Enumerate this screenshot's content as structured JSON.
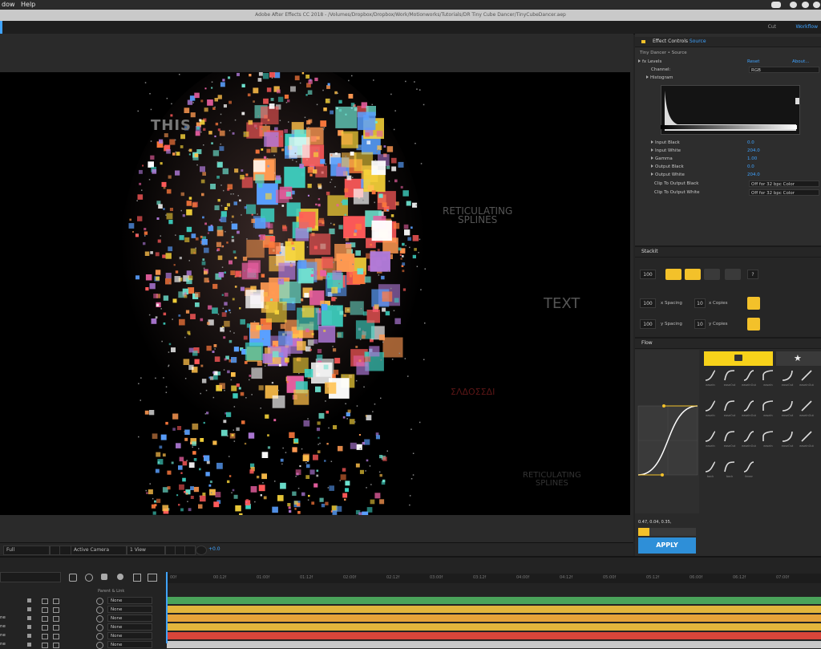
{
  "menubar": {
    "items": [
      "dow",
      "Help"
    ]
  },
  "titlebar": {
    "title": "Adobe After Effects CC 2018 - /Volumes/Dropbox/Dropbox/Work/Motionworks/Tutorials/DR Tiny Cube Dancer/TinyCubeDancer.aep"
  },
  "workspace": {
    "cut": "Cut",
    "workflow": "Workflow"
  },
  "canvas": {
    "word_this": "THIS",
    "word_reticulating": "RETICULATING",
    "word_splines": "SPLINES",
    "word_text": "TEXT",
    "word_red": "ΣΛΔΟΣΣΔΙ",
    "word_bottom1": "RETICULATING",
    "word_bottom2": "SPLINES"
  },
  "viewer_bar": {
    "resolution": "Full",
    "camera": "Active Camera",
    "views": "1 View",
    "exposure": "+0.0"
  },
  "effect_controls": {
    "tab": "Effect Controls",
    "tab_layer": "Source",
    "layer_path": "Tiny Dancer • Source",
    "effect_name": "Levels",
    "reset": "Reset",
    "about": "About...",
    "channel_label": "Channel:",
    "channel_value": "RGB",
    "histogram_label": "Histogram",
    "params": [
      {
        "label": "Input Black",
        "value": "0.0"
      },
      {
        "label": "Input White",
        "value": "204.0"
      },
      {
        "label": "Gamma",
        "value": "1.00"
      },
      {
        "label": "Output Black",
        "value": "0.0"
      },
      {
        "label": "Output White",
        "value": "204.0"
      }
    ],
    "clip_black_label": "Clip To Output Black",
    "clip_black_value": "Off for 32 bpc Color",
    "clip_white_label": "Clip To Output White",
    "clip_white_value": "Off for 32 bpc Color"
  },
  "stackit": {
    "title": "Stackit",
    "copies_value": "100",
    "x_value": "100",
    "x_label": "x Spacing",
    "x_copies_value": "10",
    "x_copies_label": "x Copies",
    "y_value": "100",
    "y_label": "y Spacing",
    "y_copies_value": "10",
    "y_copies_label": "y Copies",
    "help": "?"
  },
  "flow": {
    "title": "Flow",
    "apply_label": "APPLY",
    "bezier_readout": "0.47, 0.04, 0.35,",
    "presets": [
      "easeIn",
      "easeOut",
      "easeInOut",
      "easeIn",
      "easeOut",
      "easeInOut",
      "easeIn",
      "easeOut",
      "easeInOut",
      "easeIn",
      "easeOut",
      "easeInOut",
      "easeIn",
      "easeOut",
      "easeInOut",
      "easeIn",
      "easeOut",
      "easeInOut",
      "back",
      "back",
      "linear"
    ]
  },
  "timeline": {
    "parent_header": "Parent & Link",
    "rows": [
      {
        "name": "",
        "parent": "None"
      },
      {
        "name": "",
        "parent": "None"
      },
      {
        "name": "ne",
        "parent": "None"
      },
      {
        "name": "ne",
        "parent": "None"
      },
      {
        "name": "ne",
        "parent": "None"
      },
      {
        "name": "ne",
        "parent": "None"
      }
    ],
    "ticks": [
      "00f",
      "00:12f",
      "01:00f",
      "01:12f",
      "02:00f",
      "02:12f",
      "03:00f",
      "03:12f",
      "04:00f",
      "04:12f",
      "05:00f",
      "05:12f",
      "06:00f",
      "06:12f",
      "07:00f"
    ]
  },
  "colors": {
    "accent": "#3fa3ff",
    "yellow": "#f3c12a",
    "apply": "#2e8fd8"
  }
}
